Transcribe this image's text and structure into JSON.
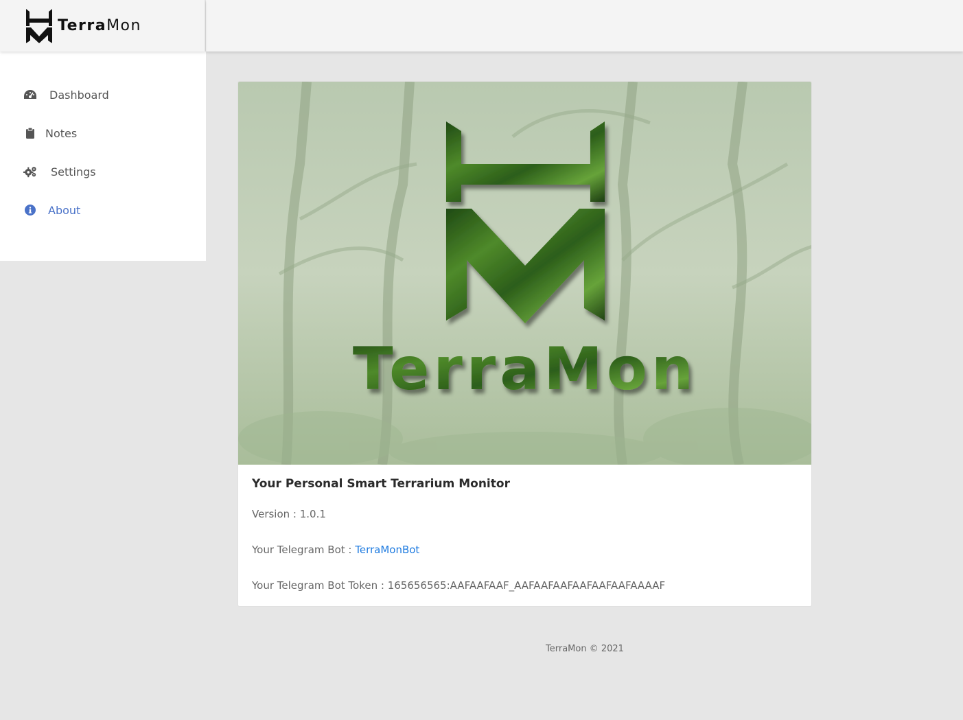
{
  "brand": {
    "name_bold": "Terra",
    "name_light": "Mon"
  },
  "sidebar": {
    "items": [
      {
        "label": "Dashboard",
        "icon": "tachometer-icon",
        "active": false
      },
      {
        "label": "Notes",
        "icon": "clipboard-icon",
        "active": false
      },
      {
        "label": "Settings",
        "icon": "gears-icon",
        "active": false
      },
      {
        "label": "About",
        "icon": "info-circle-icon",
        "active": true
      }
    ]
  },
  "about": {
    "hero_text": "TerraMon",
    "title": "Your Personal Smart Terrarium Monitor",
    "version_label": "Version : ",
    "version_value": "1.0.1",
    "bot_label": "Your Telegram Bot : ",
    "bot_link": "TerraMonBot",
    "token_label": "Your Telegram Bot Token : ",
    "token_value": "165656565:AAFAAFAAF_AAFAAFAAFAAFAAFAAFAAAAF"
  },
  "footer": {
    "text": "TerraMon © 2021"
  },
  "colors": {
    "accent": "#4a72c8",
    "link": "#1e7be0",
    "background": "#e6e6e6",
    "forest_green": "#3a6b2a"
  }
}
